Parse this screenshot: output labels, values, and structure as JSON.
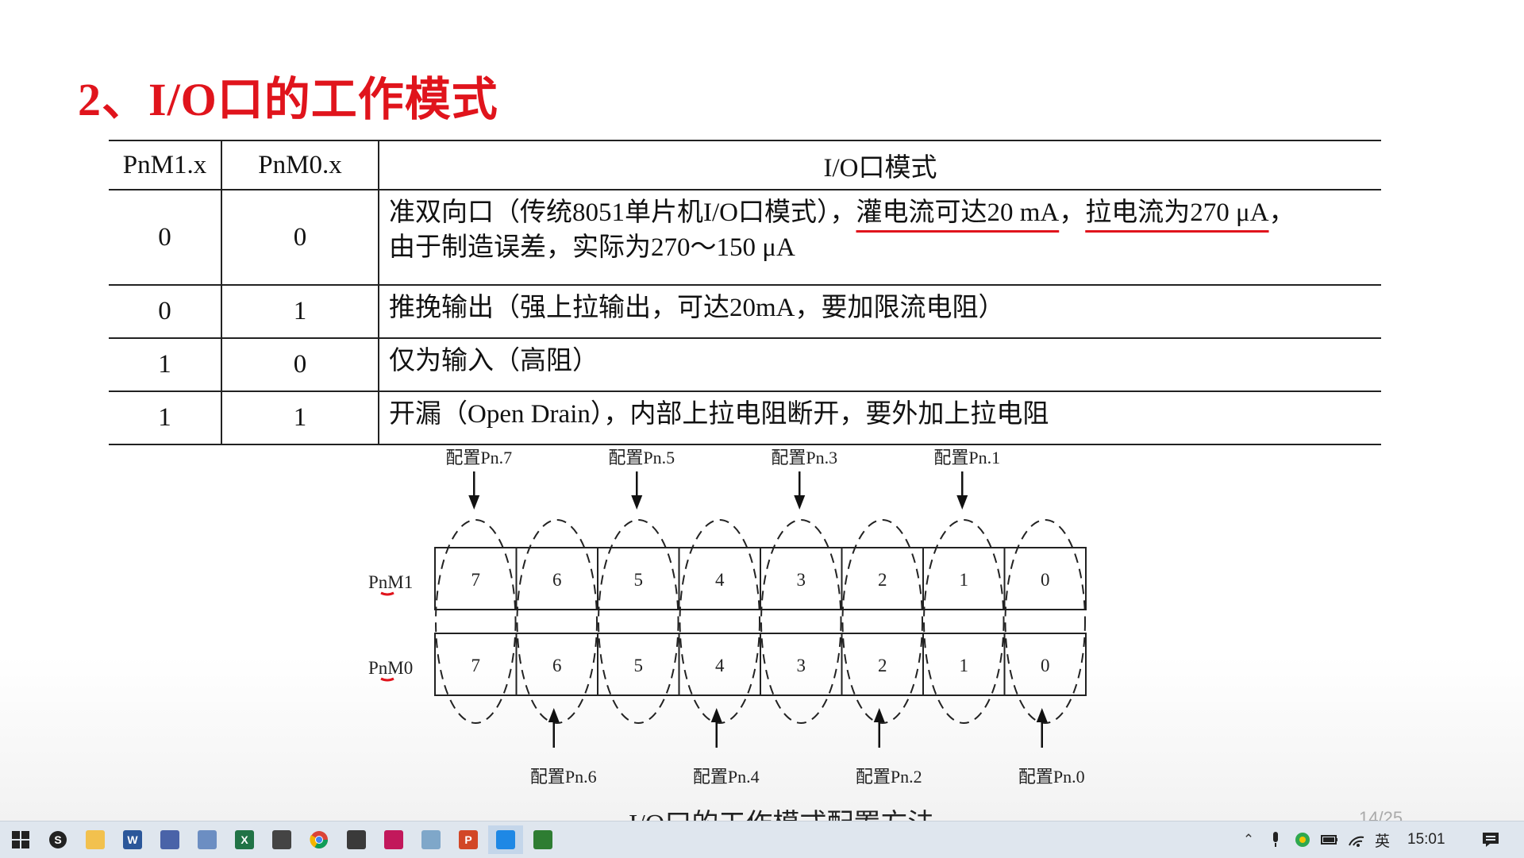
{
  "slide": {
    "title": "2、I/O口的工作模式",
    "table": {
      "headers": [
        "PnM1.x",
        "PnM0.x",
        "I/O口模式"
      ],
      "rows": [
        {
          "m1": "0",
          "m0": "0",
          "desc_a": "准双向口（传统8051单片机I/O口模式），",
          "desc_b": "灌电流可达20 mA",
          "desc_c": "，",
          "desc_d": "拉电流为270 μA",
          "desc_e": "，",
          "desc_f": "由于制造误差，实际为270～150 μA"
        },
        {
          "m1": "0",
          "m0": "1",
          "desc": "推挽输出（强上拉输出，可达20mA，要加限流电阻）"
        },
        {
          "m1": "1",
          "m0": "0",
          "desc": "仅为输入（高阻）"
        },
        {
          "m1": "1",
          "m0": "1",
          "desc": "开漏（Open Drain），内部上拉电阻断开，要外加上拉电阻"
        }
      ]
    },
    "diagram": {
      "row_labels": [
        "PnM1",
        "PnM0"
      ],
      "bits": [
        "7",
        "6",
        "5",
        "4",
        "3",
        "2",
        "1",
        "0"
      ],
      "top_labels": [
        "配置Pn.7",
        "配置Pn.5",
        "配置Pn.3",
        "配置Pn.1"
      ],
      "bottom_labels": [
        "配置Pn.6",
        "配置Pn.4",
        "配置Pn.2",
        "配置Pn.0"
      ]
    },
    "caption": "I/O口的工作模式配置方法",
    "page_number": "14/25"
  },
  "taskbar": {
    "apps": [
      {
        "icon": "windows-start-icon"
      },
      {
        "icon": "app-s-icon"
      },
      {
        "icon": "file-explorer-icon"
      },
      {
        "icon": "word-icon",
        "letter": "W"
      },
      {
        "icon": "building-app-icon"
      },
      {
        "icon": "window-app-icon"
      },
      {
        "icon": "excel-icon",
        "letter": "X"
      },
      {
        "icon": "book-app-icon"
      },
      {
        "icon": "chrome-icon"
      },
      {
        "icon": "ebook-reader-icon"
      },
      {
        "icon": "rss-app-icon"
      },
      {
        "icon": "notes-app-icon"
      },
      {
        "icon": "powerpoint-icon",
        "letter": "P"
      },
      {
        "icon": "photos-app-icon"
      },
      {
        "icon": "terminal-app-icon"
      }
    ],
    "tray": {
      "input_method": "英",
      "time": "15:01"
    }
  }
}
